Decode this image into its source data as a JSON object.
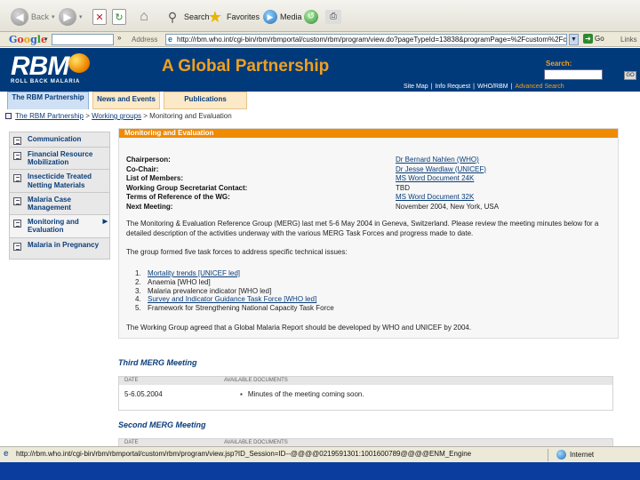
{
  "browser": {
    "toolbar": {
      "back_label": "Back",
      "search_label": "Search",
      "favorites_label": "Favorites",
      "media_label": "Media"
    },
    "google_bar": {
      "brand": [
        "G",
        "o",
        "o",
        "g",
        "l",
        "e"
      ],
      "dropdown": "▾"
    },
    "address_label": "Address",
    "address_value": "http://rbm.who.int/cgi-bin/rbm/rbmportal/custom/rbm/program/view.do?pageTypeId=13838&programPage=%2Fcustom%2Fc",
    "go_label": "Go",
    "links_label": "Links"
  },
  "header": {
    "logo_text": "RBM",
    "logo_sub": "ROLL BACK MALARIA",
    "tagline": "A Global Partnership",
    "search_label": "Search:",
    "search_go": "GO",
    "top_links": [
      "Site Map",
      "Info Request",
      "WHO/RBM"
    ],
    "advanced_search": "Advanced Search"
  },
  "tabs": [
    {
      "label": "The RBM Partnership"
    },
    {
      "label": "News and Events"
    },
    {
      "label": "Publications"
    }
  ],
  "breadcrumb": {
    "items": [
      "The RBM Partnership",
      "Working groups",
      "Monitoring and Evaluation"
    ],
    "separator": ">"
  },
  "sidenav": [
    {
      "label": "Communication"
    },
    {
      "label": "Financial Resource Mobilization"
    },
    {
      "label": "Insecticide Treated Netting Materials"
    },
    {
      "label": "Malaria Case Management"
    },
    {
      "label": "Monitoring and Evaluation"
    },
    {
      "label": "Malaria in Pregnancy"
    }
  ],
  "main": {
    "section_header": "Monitoring and Evaluation",
    "fields": [
      {
        "label": "Chairperson:",
        "value": "Dr Bernard Nahlen (WHO)"
      },
      {
        "label": "Co-Chair:",
        "value": "Dr Jesse Wardlaw (UNICEF)"
      },
      {
        "label": "List of Members:",
        "value": "MS Word Document 24K"
      },
      {
        "label": "Working Group Secretariat Contact:",
        "value": "TBD"
      },
      {
        "label": "Terms of Reference of the WG:",
        "value": "MS Word Document 32K"
      },
      {
        "label": "Next Meeting:",
        "value": "November 2004, New York, USA"
      }
    ],
    "paragraph1": "The Monitoring & Evaluation Reference Group (MERG) last met 5-6 May 2004 in Geneva, Switzerland. Please review the meeting minutes below for a detailed description of the activities underway with the various MERG Task Forces and progress made to date.",
    "paragraph2": "The group formed five task forces to address specific technical issues:",
    "task_forces": [
      "Mortality trends [UNICEF led]",
      "Anaemia [WHO led]",
      "Malaria prevalence indicator [WHO led]",
      "Survey and Indicator Guidance Task Force [WHO led]",
      "Framework for Strengthening National Capacity Task Force"
    ],
    "paragraph3": "The Working Group agreed that a Global Malaria Report should be developed by WHO and UNICEF by 2004."
  },
  "meetings": [
    {
      "title": "Third MERG Meeting",
      "col_date": "DATE",
      "col_docs": "AVAILABLE DOCUMENTS",
      "date": "5-6.05.2004",
      "document": "Minutes of the meeting coming soon."
    },
    {
      "title": "Second MERG Meeting",
      "col_date": "DATE",
      "col_docs": "AVAILABLE DOCUMENTS"
    }
  ],
  "status_bar": {
    "url": "http://rbm.who.int/cgi-bin/rbm/rbmportal/custom/rbm/program/view.jsp?ID_Session=ID--@@@@0219591301:1001600789@@@@ENM_Engine",
    "zone": "Internet"
  },
  "colors": {
    "header_bg": "#003a7a",
    "accent_orange": "#f08a00",
    "link_blue": "#0a3d7a",
    "taskbar": "#0a3d9e"
  }
}
